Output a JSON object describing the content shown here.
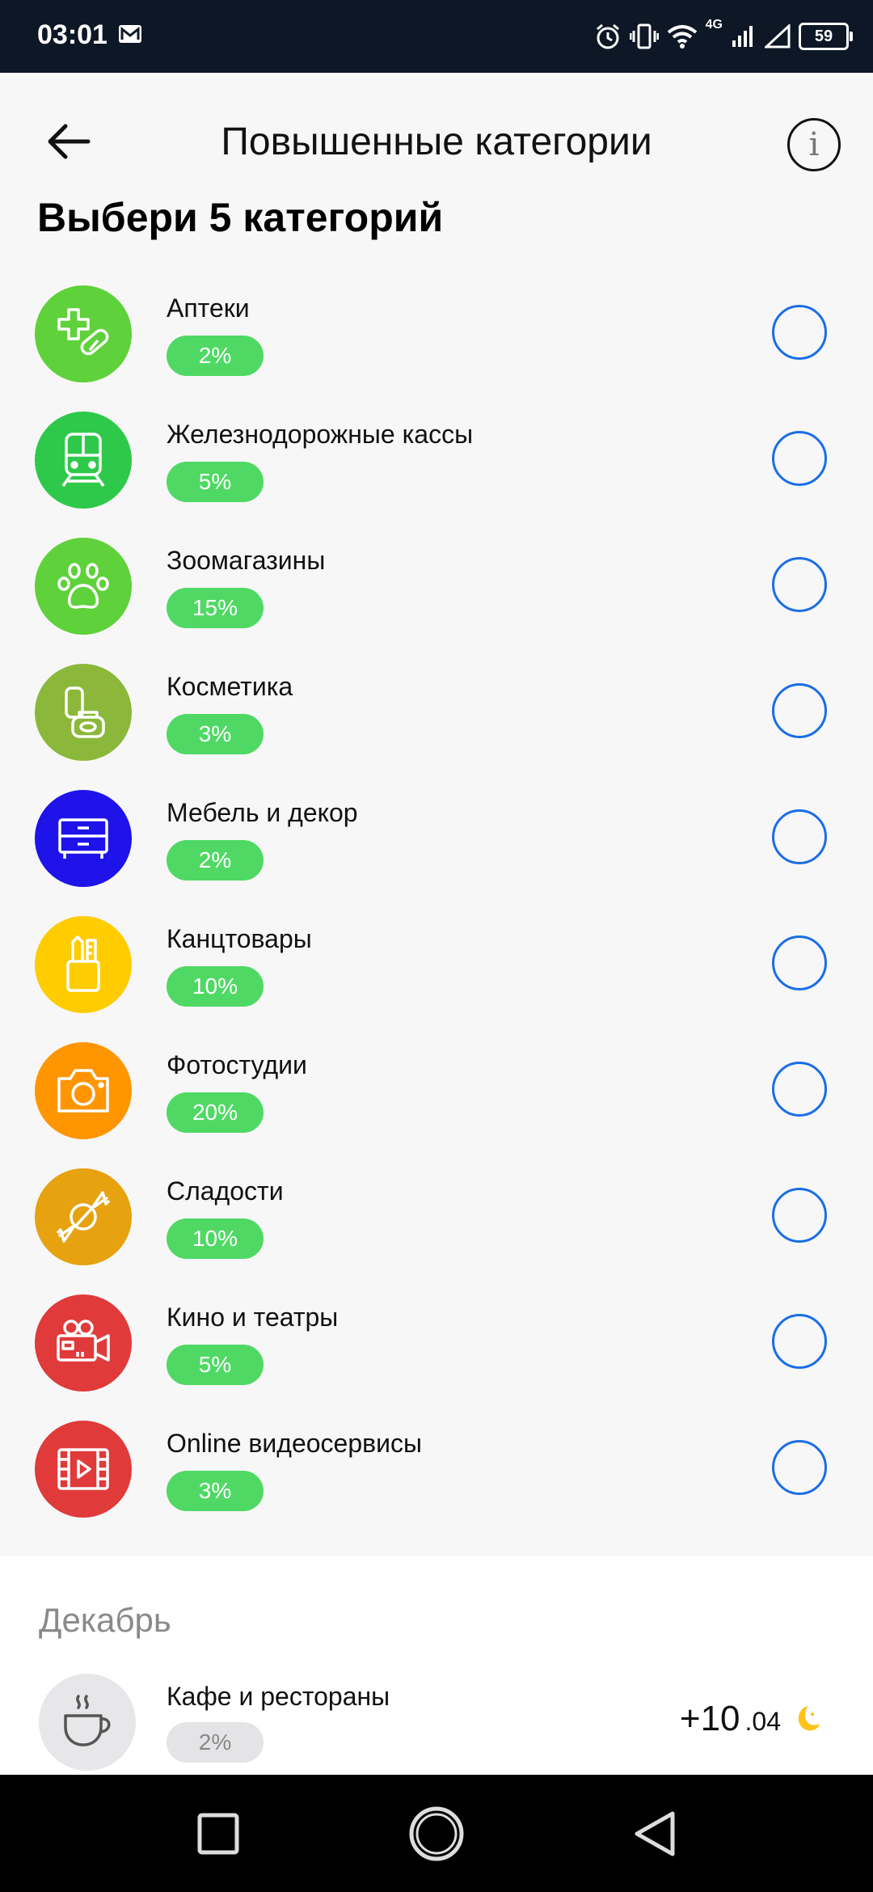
{
  "status_bar": {
    "time": "03:01",
    "network": "4G",
    "battery": "59"
  },
  "header": {
    "title": "Повышенные категории"
  },
  "section": {
    "heading": "Выбери 5 категорий"
  },
  "categories": [
    {
      "name": "Аптеки",
      "percent": "2%",
      "icon": "pharmacy-icon",
      "color": "#5fd13a"
    },
    {
      "name": "Железнодорожные кассы",
      "percent": "5%",
      "icon": "train-icon",
      "color": "#2ec94a"
    },
    {
      "name": "Зоомагазины",
      "percent": "15%",
      "icon": "paw-icon",
      "color": "#5fd13a"
    },
    {
      "name": "Косметика",
      "percent": "3%",
      "icon": "cosmetics-icon",
      "color": "#8bb83a"
    },
    {
      "name": "Мебель и декор",
      "percent": "2%",
      "icon": "furniture-icon",
      "color": "#1e13e8"
    },
    {
      "name": "Канцтовары",
      "percent": "10%",
      "icon": "stationery-icon",
      "color": "#ffcc00"
    },
    {
      "name": "Фотостудии",
      "percent": "20%",
      "icon": "camera-icon",
      "color": "#ff9500"
    },
    {
      "name": "Сладости",
      "percent": "10%",
      "icon": "candy-icon",
      "color": "#e6a20f"
    },
    {
      "name": "Кино и театры",
      "percent": "5%",
      "icon": "movie-camera-icon",
      "color": "#e03a3a"
    },
    {
      "name": "Online видеосервисы",
      "percent": "3%",
      "icon": "film-icon",
      "color": "#e03a3a"
    }
  ],
  "december": {
    "month": "Декабрь",
    "item": {
      "name": "Кафе и рестораны",
      "percent": "2%",
      "amount_main": "+10",
      "amount_decimal": ".04",
      "icon": "coffee-cup-icon"
    }
  },
  "colors": {
    "accent_blue": "#1a6ee6",
    "badge_green": "#4fd964",
    "status_bar": "#0e1726"
  }
}
